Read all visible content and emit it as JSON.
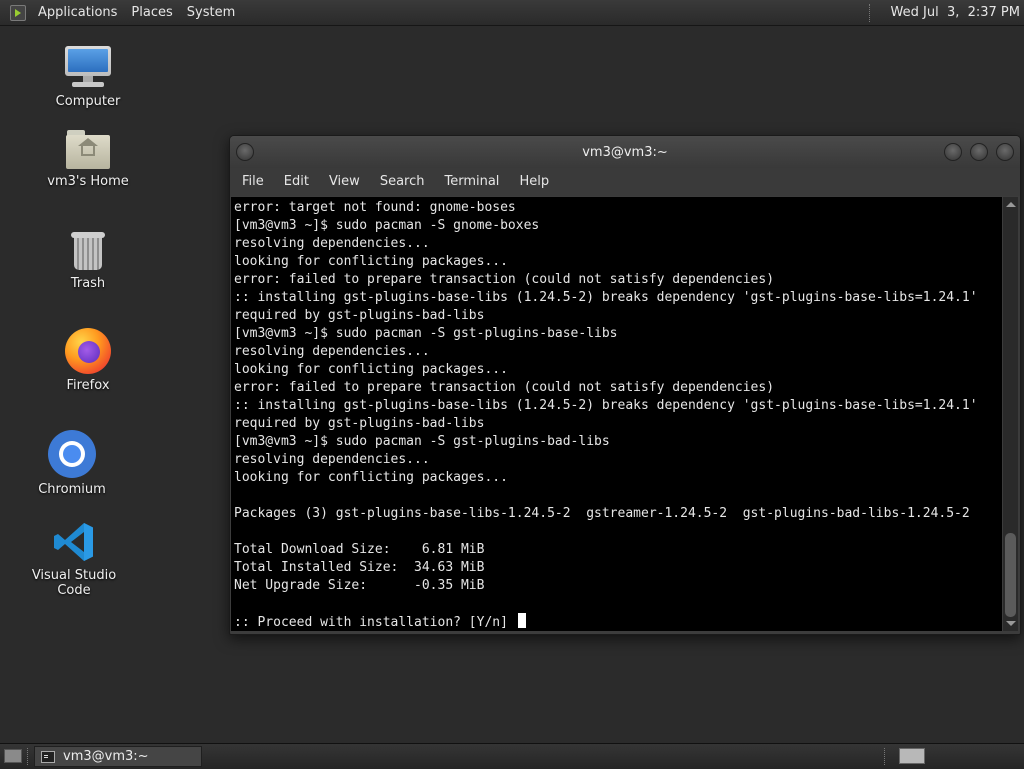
{
  "top_panel": {
    "menus": [
      "Applications",
      "Places",
      "System"
    ],
    "clock": "Wed Jul  3,  2:37 PM"
  },
  "desktop_icons": [
    {
      "label": "Computer",
      "icon": "computer-icon"
    },
    {
      "label": "vm3's Home",
      "icon": "home-folder-icon"
    },
    {
      "label": "Trash",
      "icon": "trash-icon"
    },
    {
      "label": "Firefox",
      "icon": "firefox-icon"
    },
    {
      "label": "Chromium",
      "icon": "chromium-icon"
    },
    {
      "label": "Visual Studio Code",
      "icon": "vscode-icon"
    }
  ],
  "terminal": {
    "title": "vm3@vm3:~",
    "menu": [
      "File",
      "Edit",
      "View",
      "Search",
      "Terminal",
      "Help"
    ],
    "lines": [
      "error: target not found: gnome-boses",
      "[vm3@vm3 ~]$ sudo pacman -S gnome-boxes",
      "resolving dependencies...",
      "looking for conflicting packages...",
      "error: failed to prepare transaction (could not satisfy dependencies)",
      ":: installing gst-plugins-base-libs (1.24.5-2) breaks dependency 'gst-plugins-base-libs=1.24.1'",
      "required by gst-plugins-bad-libs",
      "[vm3@vm3 ~]$ sudo pacman -S gst-plugins-base-libs",
      "resolving dependencies...",
      "looking for conflicting packages...",
      "error: failed to prepare transaction (could not satisfy dependencies)",
      ":: installing gst-plugins-base-libs (1.24.5-2) breaks dependency 'gst-plugins-base-libs=1.24.1'",
      "required by gst-plugins-bad-libs",
      "[vm3@vm3 ~]$ sudo pacman -S gst-plugins-bad-libs",
      "resolving dependencies...",
      "looking for conflicting packages...",
      "",
      "Packages (3) gst-plugins-base-libs-1.24.5-2  gstreamer-1.24.5-2  gst-plugins-bad-libs-1.24.5-2",
      "",
      "Total Download Size:    6.81 MiB",
      "Total Installed Size:  34.63 MiB",
      "Net Upgrade Size:      -0.35 MiB",
      ""
    ],
    "prompt_line": ":: Proceed with installation? [Y/n] "
  },
  "taskbar": {
    "window_title": "vm3@vm3:~"
  }
}
